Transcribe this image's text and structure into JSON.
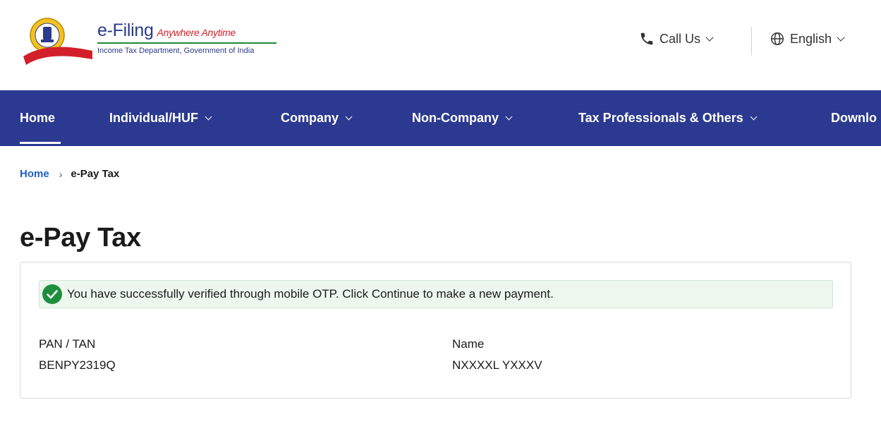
{
  "header": {
    "brand_main": "e-Filing",
    "brand_tagline": "Anywhere Anytime",
    "brand_sub": "Income Tax Department, Government of India",
    "call_us": "Call Us",
    "language": "English"
  },
  "nav": {
    "items": [
      {
        "label": "Home"
      },
      {
        "label": "Individual/HUF"
      },
      {
        "label": "Company"
      },
      {
        "label": "Non-Company"
      },
      {
        "label": "Tax Professionals & Others"
      },
      {
        "label": "Downlo"
      }
    ]
  },
  "breadcrumb": {
    "home": "Home",
    "current": "e-Pay Tax"
  },
  "page": {
    "title": "e-Pay Tax"
  },
  "alert": {
    "message": "You have successfully verified through mobile OTP. Click Continue to make a new payment."
  },
  "details": {
    "pan_label": "PAN / TAN",
    "pan_value": "BENPY2319Q",
    "name_label": "Name",
    "name_value": "NXXXXL YXXXV"
  },
  "colors": {
    "nav_bg": "#2b3990",
    "link": "#1f5fbf",
    "success": "#1e8e3e",
    "alert_bg": "#edf7ee"
  }
}
